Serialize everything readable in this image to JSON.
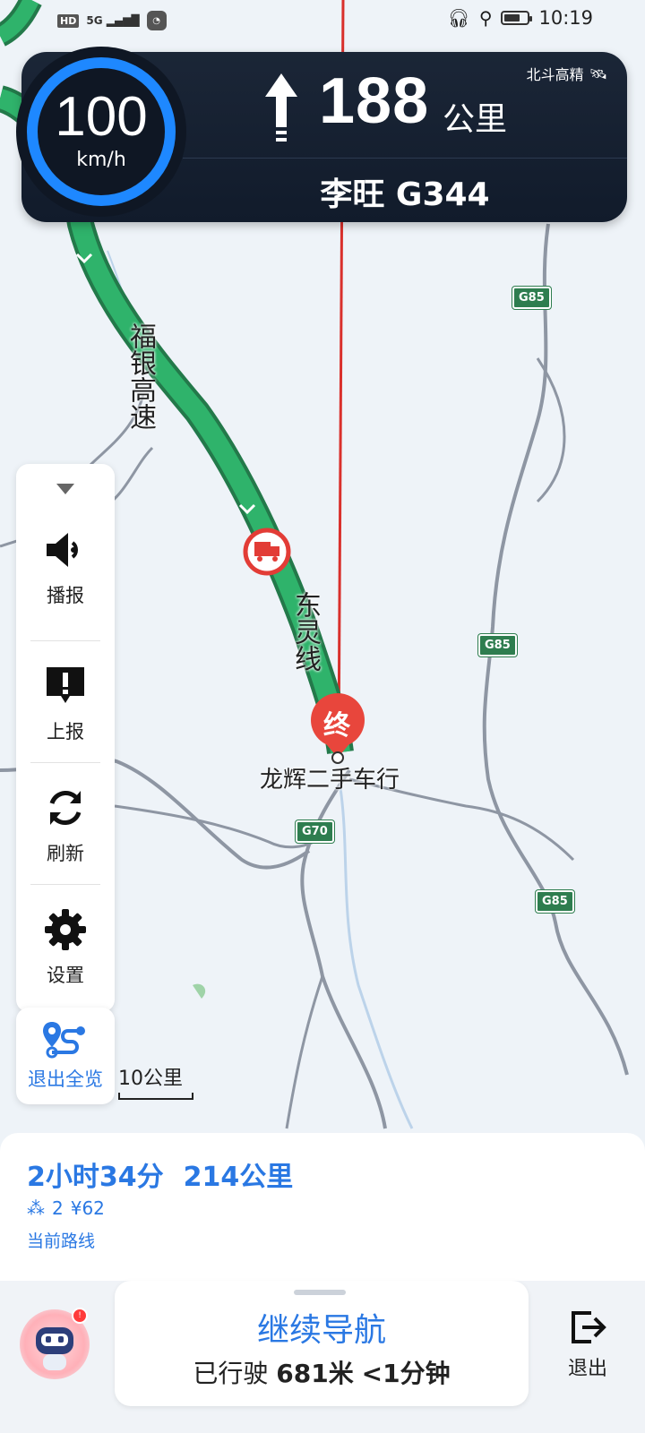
{
  "status_bar": {
    "hd": "HD",
    "network": "5G",
    "time": "10:19"
  },
  "nav": {
    "distance": "188",
    "distance_unit": "公里",
    "street": "李旺 G344",
    "gnss_label": "北斗高精",
    "speed": "100",
    "speed_unit": "km/h",
    "maneuver_icon": "straight-arrow-icon"
  },
  "map": {
    "road_name_1": "福银高速",
    "road_name_2": "东灵线",
    "destination_marker": "终",
    "destination_name": "龙辉二手车行",
    "highway_badges": [
      "G85",
      "G85",
      "G85",
      "G70"
    ],
    "scale": "10公里"
  },
  "toolbar": {
    "items": [
      {
        "label": "播报",
        "icon": "speaker-icon"
      },
      {
        "label": "上报",
        "icon": "report-icon"
      },
      {
        "label": "刷新",
        "icon": "refresh-icon"
      },
      {
        "label": "设置",
        "icon": "gear-icon"
      }
    ],
    "overview_label": "退出全览"
  },
  "route": {
    "duration": "2小时34分",
    "distance": "214公里",
    "lights": "2",
    "toll": "¥62",
    "current_route": "当前路线"
  },
  "bottom": {
    "continue_label": "继续导航",
    "driven_prefix": "已行驶",
    "driven_distance": "681米",
    "driven_time": "<1分钟",
    "exit_label": "退出"
  },
  "colors": {
    "route_green": "#2fb36b",
    "accent_blue": "#2a78e3",
    "nav_panel": "#1b2637",
    "destination_red": "#e8463c"
  }
}
